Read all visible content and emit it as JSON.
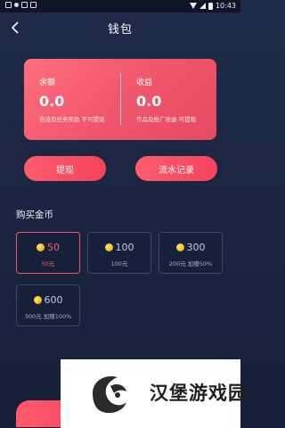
{
  "status_bar": {
    "time": "10:43"
  },
  "header": {
    "title": "钱包"
  },
  "balance_card": {
    "left": {
      "label": "余额",
      "value": "0.0",
      "note": "充值及任务奖励 不可提现"
    },
    "right": {
      "label": "收益",
      "value": "0.0",
      "note": "作品及推广收益  可提现"
    }
  },
  "actions": {
    "withdraw_label": "提现",
    "records_label": "流水记录"
  },
  "purchase": {
    "title": "购买金币",
    "packages": [
      {
        "coins": "50",
        "price": "50元",
        "selected": true
      },
      {
        "coins": "100",
        "price": "100元",
        "selected": false
      },
      {
        "coins": "300",
        "price": "200元 加赠50%",
        "selected": false
      },
      {
        "coins": "600",
        "price": "300元 加赠100%",
        "selected": false
      }
    ]
  },
  "watermark": {
    "text": "汉堡游戏园"
  },
  "colors": {
    "accent": "#f0566c",
    "background": "#1f2b48",
    "coin": "#f7c11f"
  }
}
